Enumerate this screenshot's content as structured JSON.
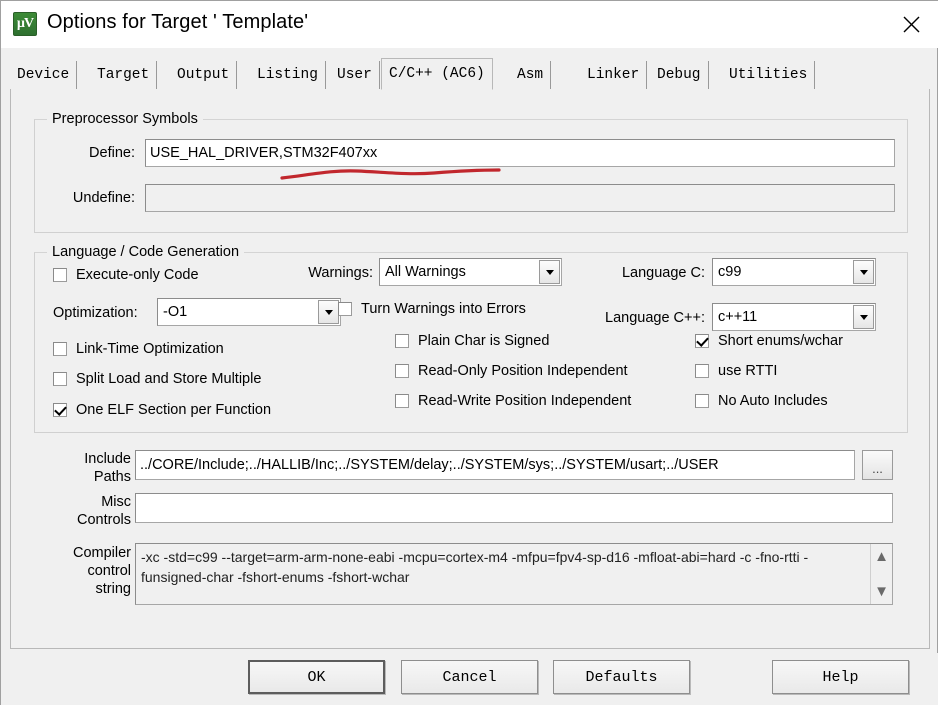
{
  "window": {
    "title": "Options for Target ' Template'",
    "icon": "keil-uvision-icon",
    "close_label": "close-icon"
  },
  "tabs": [
    {
      "label": "Device",
      "active": false
    },
    {
      "label": "Target",
      "active": false
    },
    {
      "label": "Output",
      "active": false
    },
    {
      "label": "Listing",
      "active": false
    },
    {
      "label": "User",
      "active": false
    },
    {
      "label": "C/C++ (AC6)",
      "active": true
    },
    {
      "label": "Asm",
      "active": false
    },
    {
      "label": "Linker",
      "active": false
    },
    {
      "label": "Debug",
      "active": false
    },
    {
      "label": "Utilities",
      "active": false
    }
  ],
  "preprocessor": {
    "legend": "Preprocessor Symbols",
    "define_label": "Define:",
    "define_value": "USE_HAL_DRIVER,STM32F407xx",
    "undefine_label": "Undefine:",
    "undefine_value": ""
  },
  "language": {
    "legend": "Language / Code Generation",
    "execute_only_label": "Execute-only Code",
    "execute_only_checked": false,
    "optimization_label": "Optimization:",
    "optimization_value": "-O1",
    "link_time_label": "Link-Time Optimization",
    "link_time_checked": false,
    "split_load_label": "Split Load and Store Multiple",
    "split_load_checked": false,
    "one_elf_label": "One ELF Section per Function",
    "one_elf_checked": true,
    "warnings_label": "Warnings:",
    "warnings_value": "All Warnings",
    "turn_warnings_label": "Turn Warnings into Errors",
    "turn_warnings_checked": false,
    "plain_char_label": "Plain Char is Signed",
    "plain_char_checked": false,
    "ro_position_label": "Read-Only Position Independent",
    "ro_position_checked": false,
    "rw_position_label": "Read-Write Position Independent",
    "rw_position_checked": false,
    "language_c_label": "Language C:",
    "language_c_value": "c99",
    "language_cpp_label": "Language C++:",
    "language_cpp_value": "c++11",
    "short_enums_label": "Short enums/wchar",
    "short_enums_checked": true,
    "use_rtti_label": "use RTTI",
    "use_rtti_checked": false,
    "no_auto_includes_label": "No Auto Includes",
    "no_auto_includes_checked": false
  },
  "paths": {
    "include_label_line1": "Include",
    "include_label_line2": "Paths",
    "include_value": "../CORE/Include;../HALLIB/Inc;../SYSTEM/delay;../SYSTEM/sys;../SYSTEM/usart;../USER",
    "include_browse_label": "...",
    "misc_label_line1": "Misc",
    "misc_label_line2": "Controls",
    "misc_value": "",
    "compiler_label_line1": "Compiler",
    "compiler_label_line2": "control",
    "compiler_label_line3": "string",
    "compiler_value": "-xc -std=c99 --target=arm-arm-none-eabi -mcpu=cortex-m4 -mfpu=fpv4-sp-d16 -mfloat-abi=hard -c -fno-rtti -funsigned-char -fshort-enums -fshort-wchar",
    "scroll_up_icon": "chevron-up-icon",
    "scroll_down_icon": "chevron-down-icon"
  },
  "buttons": {
    "ok": "OK",
    "cancel": "Cancel",
    "defaults": "Defaults",
    "help": "Help"
  },
  "annotation": {
    "type": "red-underline",
    "color": "#c1272d",
    "target": "STM32F407xx"
  }
}
